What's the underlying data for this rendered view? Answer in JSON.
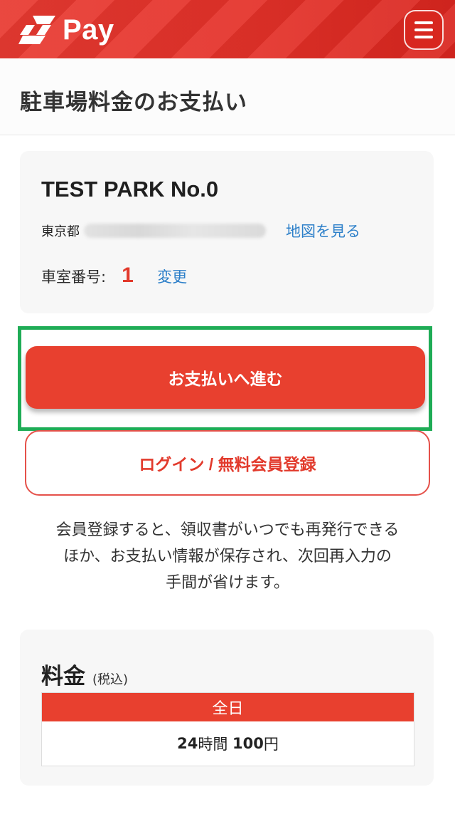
{
  "header": {
    "logo_text": "Pay",
    "logo_icon": "lightning-s-logo-icon",
    "menu_icon": "hamburger-menu-icon",
    "brand_color": "#e83a31"
  },
  "page": {
    "title": "駐車場料金のお支払い"
  },
  "parking": {
    "name": "TEST PARK No.0",
    "address_prefix": "東京都",
    "map_link": "地図を見る",
    "room_label": "車室番号:",
    "room_number": "1",
    "change_link": "変更"
  },
  "actions": {
    "pay_button": "お支払いへ進む",
    "login_button": "ログイン / 無料会員登録",
    "highlight_color": "#1fac56"
  },
  "info": {
    "line1": "会員登録すると、領収書がいつでも再発行できる",
    "line2": "ほか、お支払い情報が保存され、次回再入力の",
    "line3": "手間が省けます。"
  },
  "fee": {
    "title": "料金",
    "tax_note": "(税込)",
    "table_header": "全日",
    "hours": "24",
    "hours_unit": "時間",
    "price": "100",
    "price_unit": "円"
  }
}
